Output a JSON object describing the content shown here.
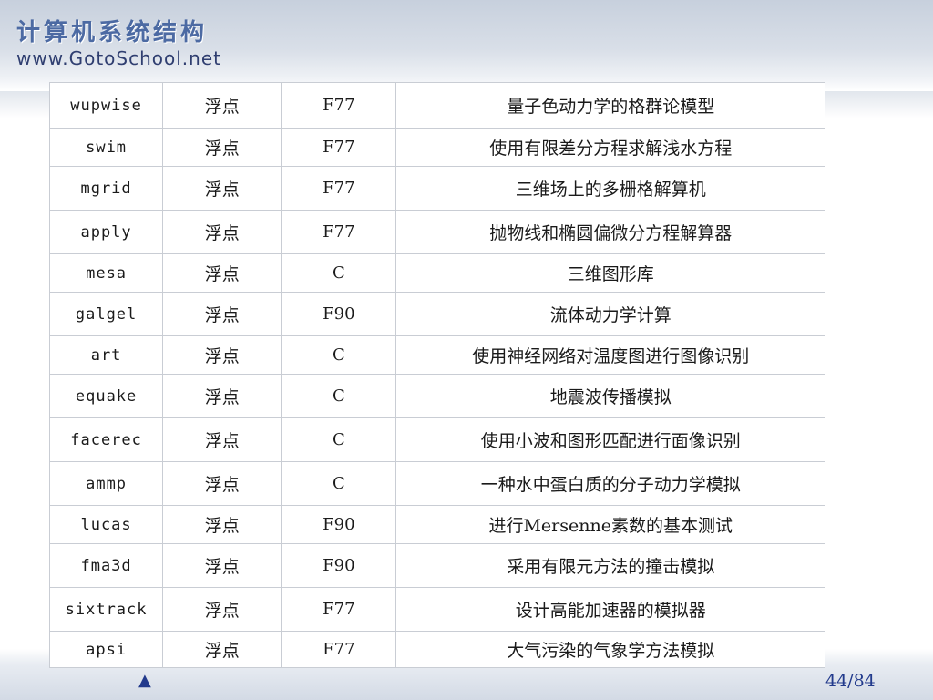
{
  "header": {
    "logo_title": "计算机系统结构",
    "logo_url": "www.GotoSchool.net"
  },
  "table": {
    "rows": [
      {
        "name": "wupwise",
        "type": "浮点",
        "lang": "F77",
        "desc": "量子色动力学的格群论模型"
      },
      {
        "name": "swim",
        "type": "浮点",
        "lang": "F77",
        "desc": "使用有限差分方程求解浅水方程"
      },
      {
        "name": "mgrid",
        "type": "浮点",
        "lang": "F77",
        "desc": "三维场上的多栅格解算机"
      },
      {
        "name": "apply",
        "type": "浮点",
        "lang": "F77",
        "desc": "抛物线和椭圆偏微分方程解算器"
      },
      {
        "name": "mesa",
        "type": "浮点",
        "lang": "C",
        "desc": "三维图形库"
      },
      {
        "name": "galgel",
        "type": "浮点",
        "lang": "F90",
        "desc": "流体动力学计算"
      },
      {
        "name": "art",
        "type": "浮点",
        "lang": "C",
        "desc": "使用神经网络对温度图进行图像识别"
      },
      {
        "name": "equake",
        "type": "浮点",
        "lang": "C",
        "desc": "地震波传播模拟"
      },
      {
        "name": "facerec",
        "type": "浮点",
        "lang": "C",
        "desc": "使用小波和图形匹配进行面像识别"
      },
      {
        "name": "ammp",
        "type": "浮点",
        "lang": "C",
        "desc": "一种水中蛋白质的分子动力学模拟"
      },
      {
        "name": "lucas",
        "type": "浮点",
        "lang": "F90",
        "desc": "进行Mersenne素数的基本测试"
      },
      {
        "name": "fma3d",
        "type": "浮点",
        "lang": "F90",
        "desc": "采用有限元方法的撞击模拟"
      },
      {
        "name": "sixtrack",
        "type": "浮点",
        "lang": "F77",
        "desc": "设计高能加速器的模拟器"
      },
      {
        "name": "apsi",
        "type": "浮点",
        "lang": "F77",
        "desc": "大气污染的气象学方法模拟"
      }
    ]
  },
  "footer": {
    "nav_up_glyph": "▲",
    "page_number": "44/84"
  },
  "colors": {
    "title_blue": "#4c6aa3",
    "url_navy": "#2f3e70",
    "nav_blue": "#223a8c",
    "table_border": "#c9cdd4"
  },
  "icons": {
    "nav_up": "up-arrow-icon"
  }
}
